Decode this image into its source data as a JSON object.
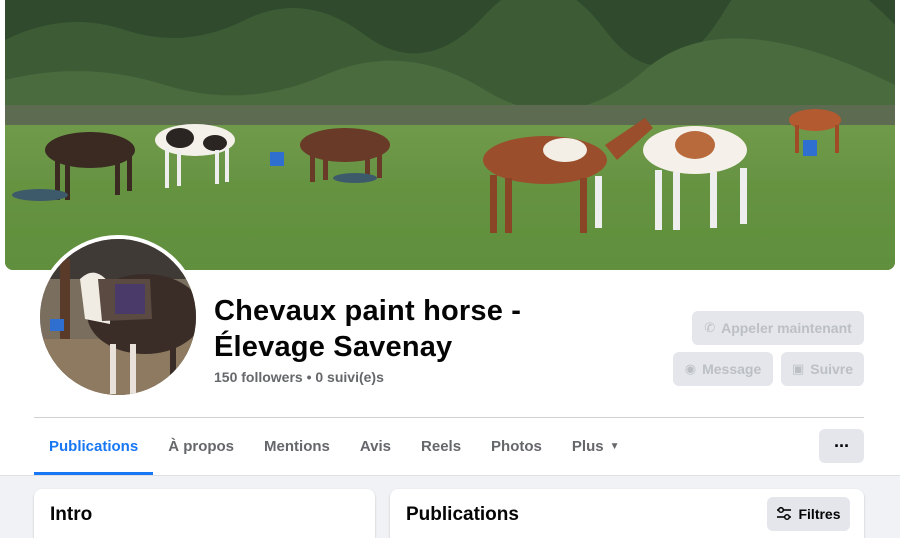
{
  "page": {
    "name": "Chevaux paint horse - Élevage Savenay",
    "stats": "150 followers • 0 suivi(e)s"
  },
  "actions": {
    "call_label": "Appeler maintenant",
    "message_label": "Message",
    "follow_label": "Suivre",
    "more_label": "···",
    "call_icon": "phone-icon",
    "message_icon": "messenger-icon",
    "follow_icon": "follow-icon"
  },
  "tabs": [
    {
      "label": "Publications",
      "active": true
    },
    {
      "label": "À propos",
      "active": false
    },
    {
      "label": "Mentions",
      "active": false
    },
    {
      "label": "Avis",
      "active": false
    },
    {
      "label": "Reels",
      "active": false
    },
    {
      "label": "Photos",
      "active": false
    },
    {
      "label": "Plus",
      "active": false
    }
  ],
  "intro": {
    "title": "Intro"
  },
  "publications": {
    "title": "Publications",
    "filter_label": "Filtres",
    "filter_icon": "sliders-icon"
  },
  "colors": {
    "accent": "#1877f2",
    "button_bg": "#e4e6eb",
    "disabled_text": "#bcc0c4",
    "page_bg": "#f0f2f5"
  }
}
